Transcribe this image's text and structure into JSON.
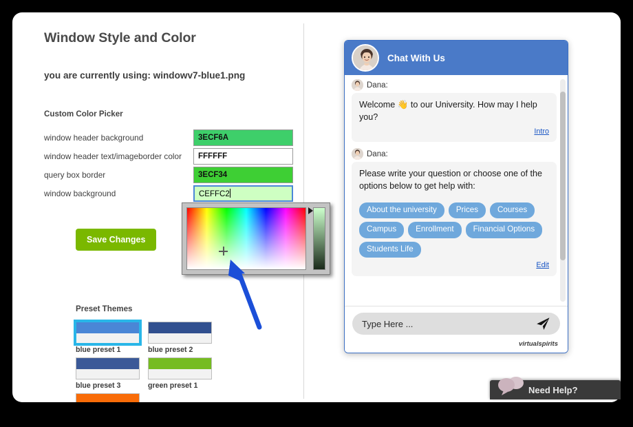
{
  "settings": {
    "page_title": "Window Style and Color",
    "current_using": "you are currently using: windowv7-blue1.png",
    "custom_picker_label": "Custom Color Picker",
    "fields": [
      {
        "label": "window header background",
        "value": "3ECF6A",
        "swatch": "#3ECF6A",
        "focused": false
      },
      {
        "label": "window header text/imageborder color",
        "value": "FFFFFF",
        "swatch": "#FFFFFF",
        "focused": false
      },
      {
        "label": "query box border",
        "value": "3ECF34",
        "swatch": "#3ECF34",
        "focused": false
      },
      {
        "label": "window background",
        "value": "CEFFC2",
        "swatch": "#CEFFC2",
        "focused": true
      }
    ],
    "save_label": "Save Changes",
    "save_color": "#7AB800",
    "presets_title": "Preset Themes",
    "presets": [
      {
        "name": "blue preset 1",
        "color": "#4a86d6",
        "selected": true
      },
      {
        "name": "blue preset 2",
        "color": "#31508f",
        "selected": false
      },
      {
        "name": "blue preset 3",
        "color": "#3b5998",
        "selected": false
      },
      {
        "name": "green preset 1",
        "color": "#76bc21",
        "selected": false
      },
      {
        "name": "",
        "color": "#f96c08",
        "selected": false
      }
    ],
    "selection_highlight": "#29B6E8"
  },
  "chat": {
    "header_title": "Chat With Us",
    "header_color": "#4A7AC8",
    "chip_color": "#6FA8DC",
    "messages": [
      {
        "sender": "Dana:",
        "text": "Welcome 👋 to our University. How may I help you?",
        "link": "Intro",
        "chips": []
      },
      {
        "sender": "Dana:",
        "text": "Please write your question or choose one of the options below to get help with:",
        "link": "Edit",
        "chips": [
          "About the university",
          "Prices",
          "Courses",
          "Campus",
          "Enrollment",
          "Financial Options",
          "Students Life"
        ]
      }
    ],
    "input_placeholder": "Type Here ...",
    "send_icon": "paper-plane-icon",
    "brand": "virtualspirits"
  },
  "need_help": {
    "label": "Need Help?"
  }
}
